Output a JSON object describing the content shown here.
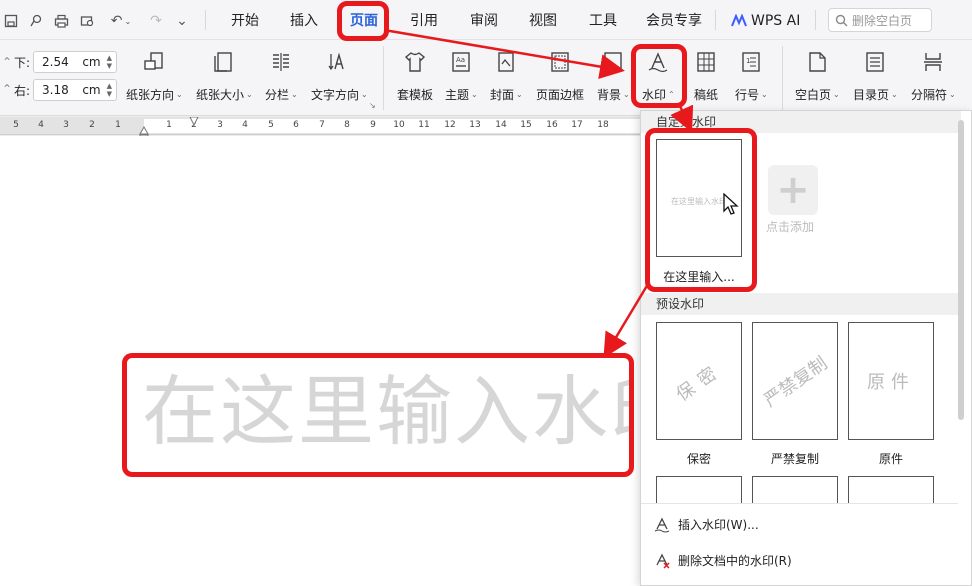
{
  "toolbar": {
    "tabs": [
      "开始",
      "插入",
      "页面",
      "引用",
      "审阅",
      "视图",
      "工具",
      "会员专享"
    ],
    "ai_label": "WPS AI",
    "search_placeholder": "删除空白页"
  },
  "ribbon": {
    "margin_bottom_label": "下:",
    "margin_bottom_value": "2.54",
    "margin_right_label": "右:",
    "margin_right_value": "3.18",
    "unit": "cm",
    "buttons": {
      "orientation": "纸张方向",
      "size": "纸张大小",
      "columns": "分栏",
      "text_direction": "文字方向",
      "template": "套模板",
      "theme": "主题",
      "cover": "封面",
      "page_border": "页面边框",
      "background": "背景",
      "watermark": "水印",
      "manuscript": "稿纸",
      "line_number": "行号",
      "blank_page": "空白页",
      "toc_page": "目录页",
      "separator": "分隔符"
    }
  },
  "ruler": {
    "numbers": [
      "5",
      "4",
      "3",
      "2",
      "1",
      "1",
      "2",
      "3",
      "4",
      "5",
      "6",
      "7",
      "8",
      "9",
      "10",
      "11",
      "12",
      "13",
      "14",
      "15",
      "16",
      "17",
      "18"
    ]
  },
  "document": {
    "watermark_text": "在这里输入水印"
  },
  "watermark_panel": {
    "custom_section": "自定义水印",
    "custom_caption": "在这里输入...",
    "custom_thumb_text": "在这里输入水印",
    "add_label": "点击添加",
    "preset_section": "预设水印",
    "presets": [
      {
        "text": "保密",
        "caption": "保密"
      },
      {
        "text": "严禁复制",
        "caption": "严禁复制"
      },
      {
        "text": "原件",
        "caption": "原件"
      }
    ],
    "insert_watermark": "插入水印(W)...",
    "delete_watermark": "删除文档中的水印(R)"
  },
  "colors": {
    "accent": "#2b63d9",
    "highlight": "#e8191d",
    "watermark": "#d6d6d6"
  }
}
